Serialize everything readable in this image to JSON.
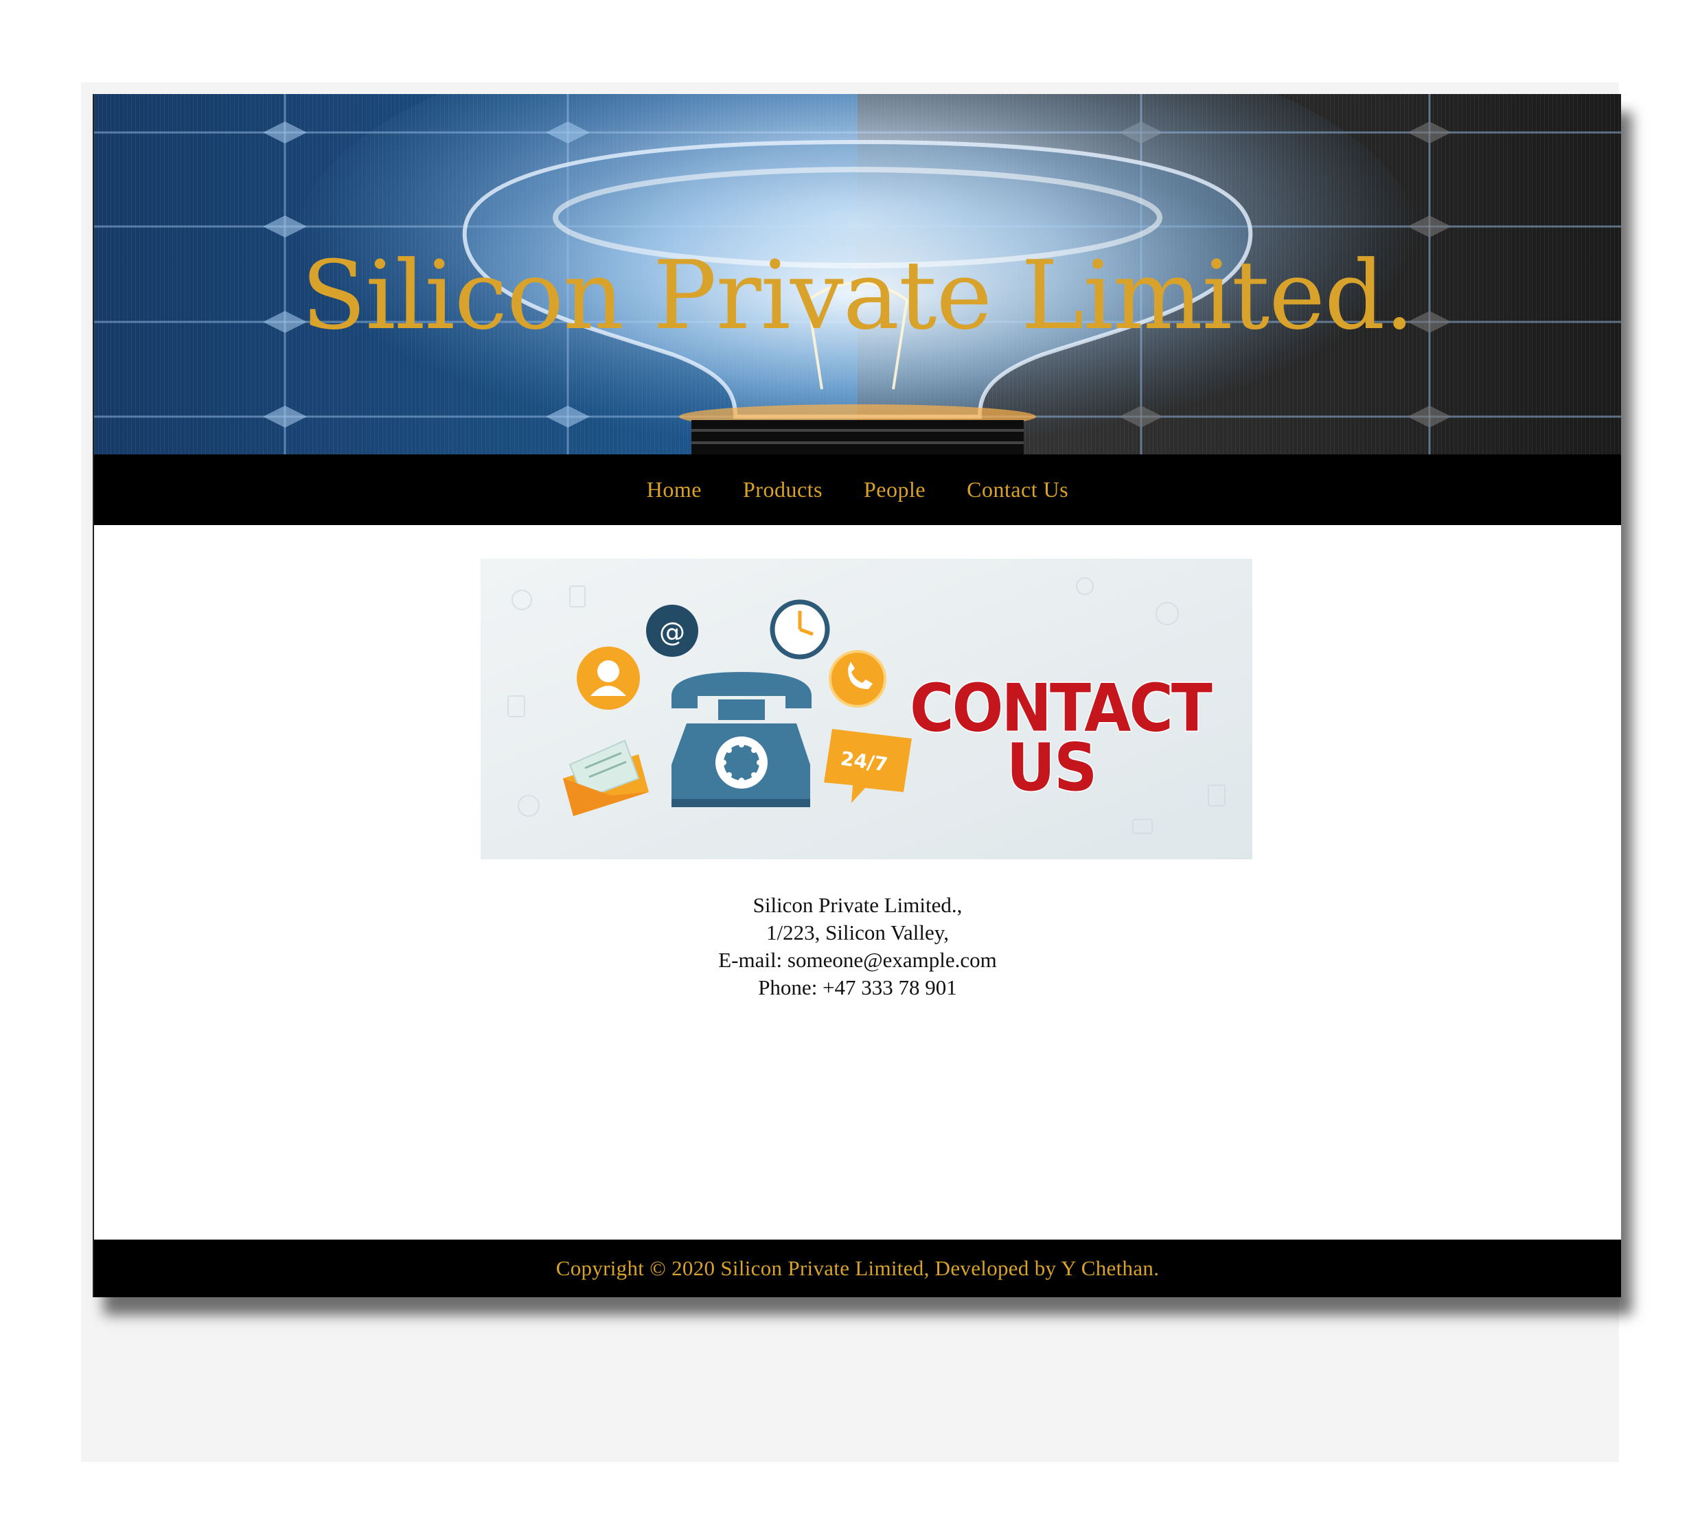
{
  "header": {
    "title": "Silicon Private Limited.",
    "banner_image": "lightbulb-over-solar-panel"
  },
  "nav": {
    "items": [
      {
        "label": "Home"
      },
      {
        "label": "Products"
      },
      {
        "label": "People"
      },
      {
        "label": "Contact Us"
      }
    ]
  },
  "contact_banner": {
    "heading_line1": "CONTACT",
    "heading_line2": "US",
    "icon_email_symbol": "@",
    "icon_badge_text": "24/7",
    "icons": [
      "at-sign-icon",
      "clock-icon",
      "user-icon",
      "phone-call-icon",
      "telephone-icon",
      "envelope-icon",
      "chat-24-7-icon"
    ]
  },
  "address": {
    "company": "Silicon Private Limited.,",
    "street": "1/223, Silicon Valley,",
    "email_line": "E-mail: someone@example.com",
    "phone_line": "Phone: +47 333 78 901"
  },
  "footer": {
    "text": "Copyright © 2020 Silicon Private Limited, Developed by Y Chethan."
  },
  "colors": {
    "accent_gold": "#d9a22b",
    "nav_bg": "#000000",
    "contact_red": "#c4161c",
    "icon_blue": "#3f7a9c",
    "icon_orange": "#f5a623"
  }
}
